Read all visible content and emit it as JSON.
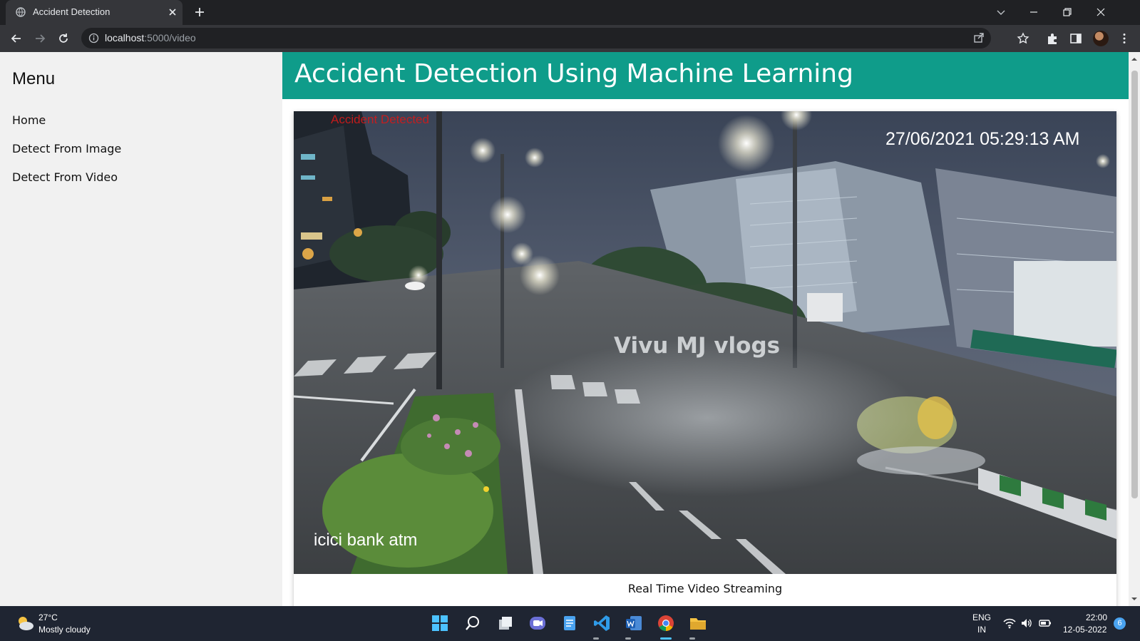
{
  "browser": {
    "tab_title": "Accident Detection",
    "url_host": "localhost",
    "url_path": ":5000/video"
  },
  "sidebar": {
    "title": "Menu",
    "items": [
      {
        "label": "Home"
      },
      {
        "label": "Detect From Image"
      },
      {
        "label": "Detect From Video"
      }
    ]
  },
  "header": {
    "title": "Accident Detection Using Machine Learning"
  },
  "video": {
    "overlay_status": "Accident Detected",
    "timestamp": "27/06/2021 05:29:13 AM",
    "watermark": "Vivu MJ vlogs",
    "location": "icici bank atm",
    "caption": "Real Time Video Streaming"
  },
  "taskbar": {
    "weather_temp": "27°C",
    "weather_condition": "Mostly cloudy",
    "lang_line1": "ENG",
    "lang_line2": "IN",
    "time": "22:00",
    "date": "12-05-2022",
    "notification_count": "6"
  },
  "colors": {
    "header_bg": "#0f9c8a",
    "overlay_status": "#d21a1a"
  }
}
